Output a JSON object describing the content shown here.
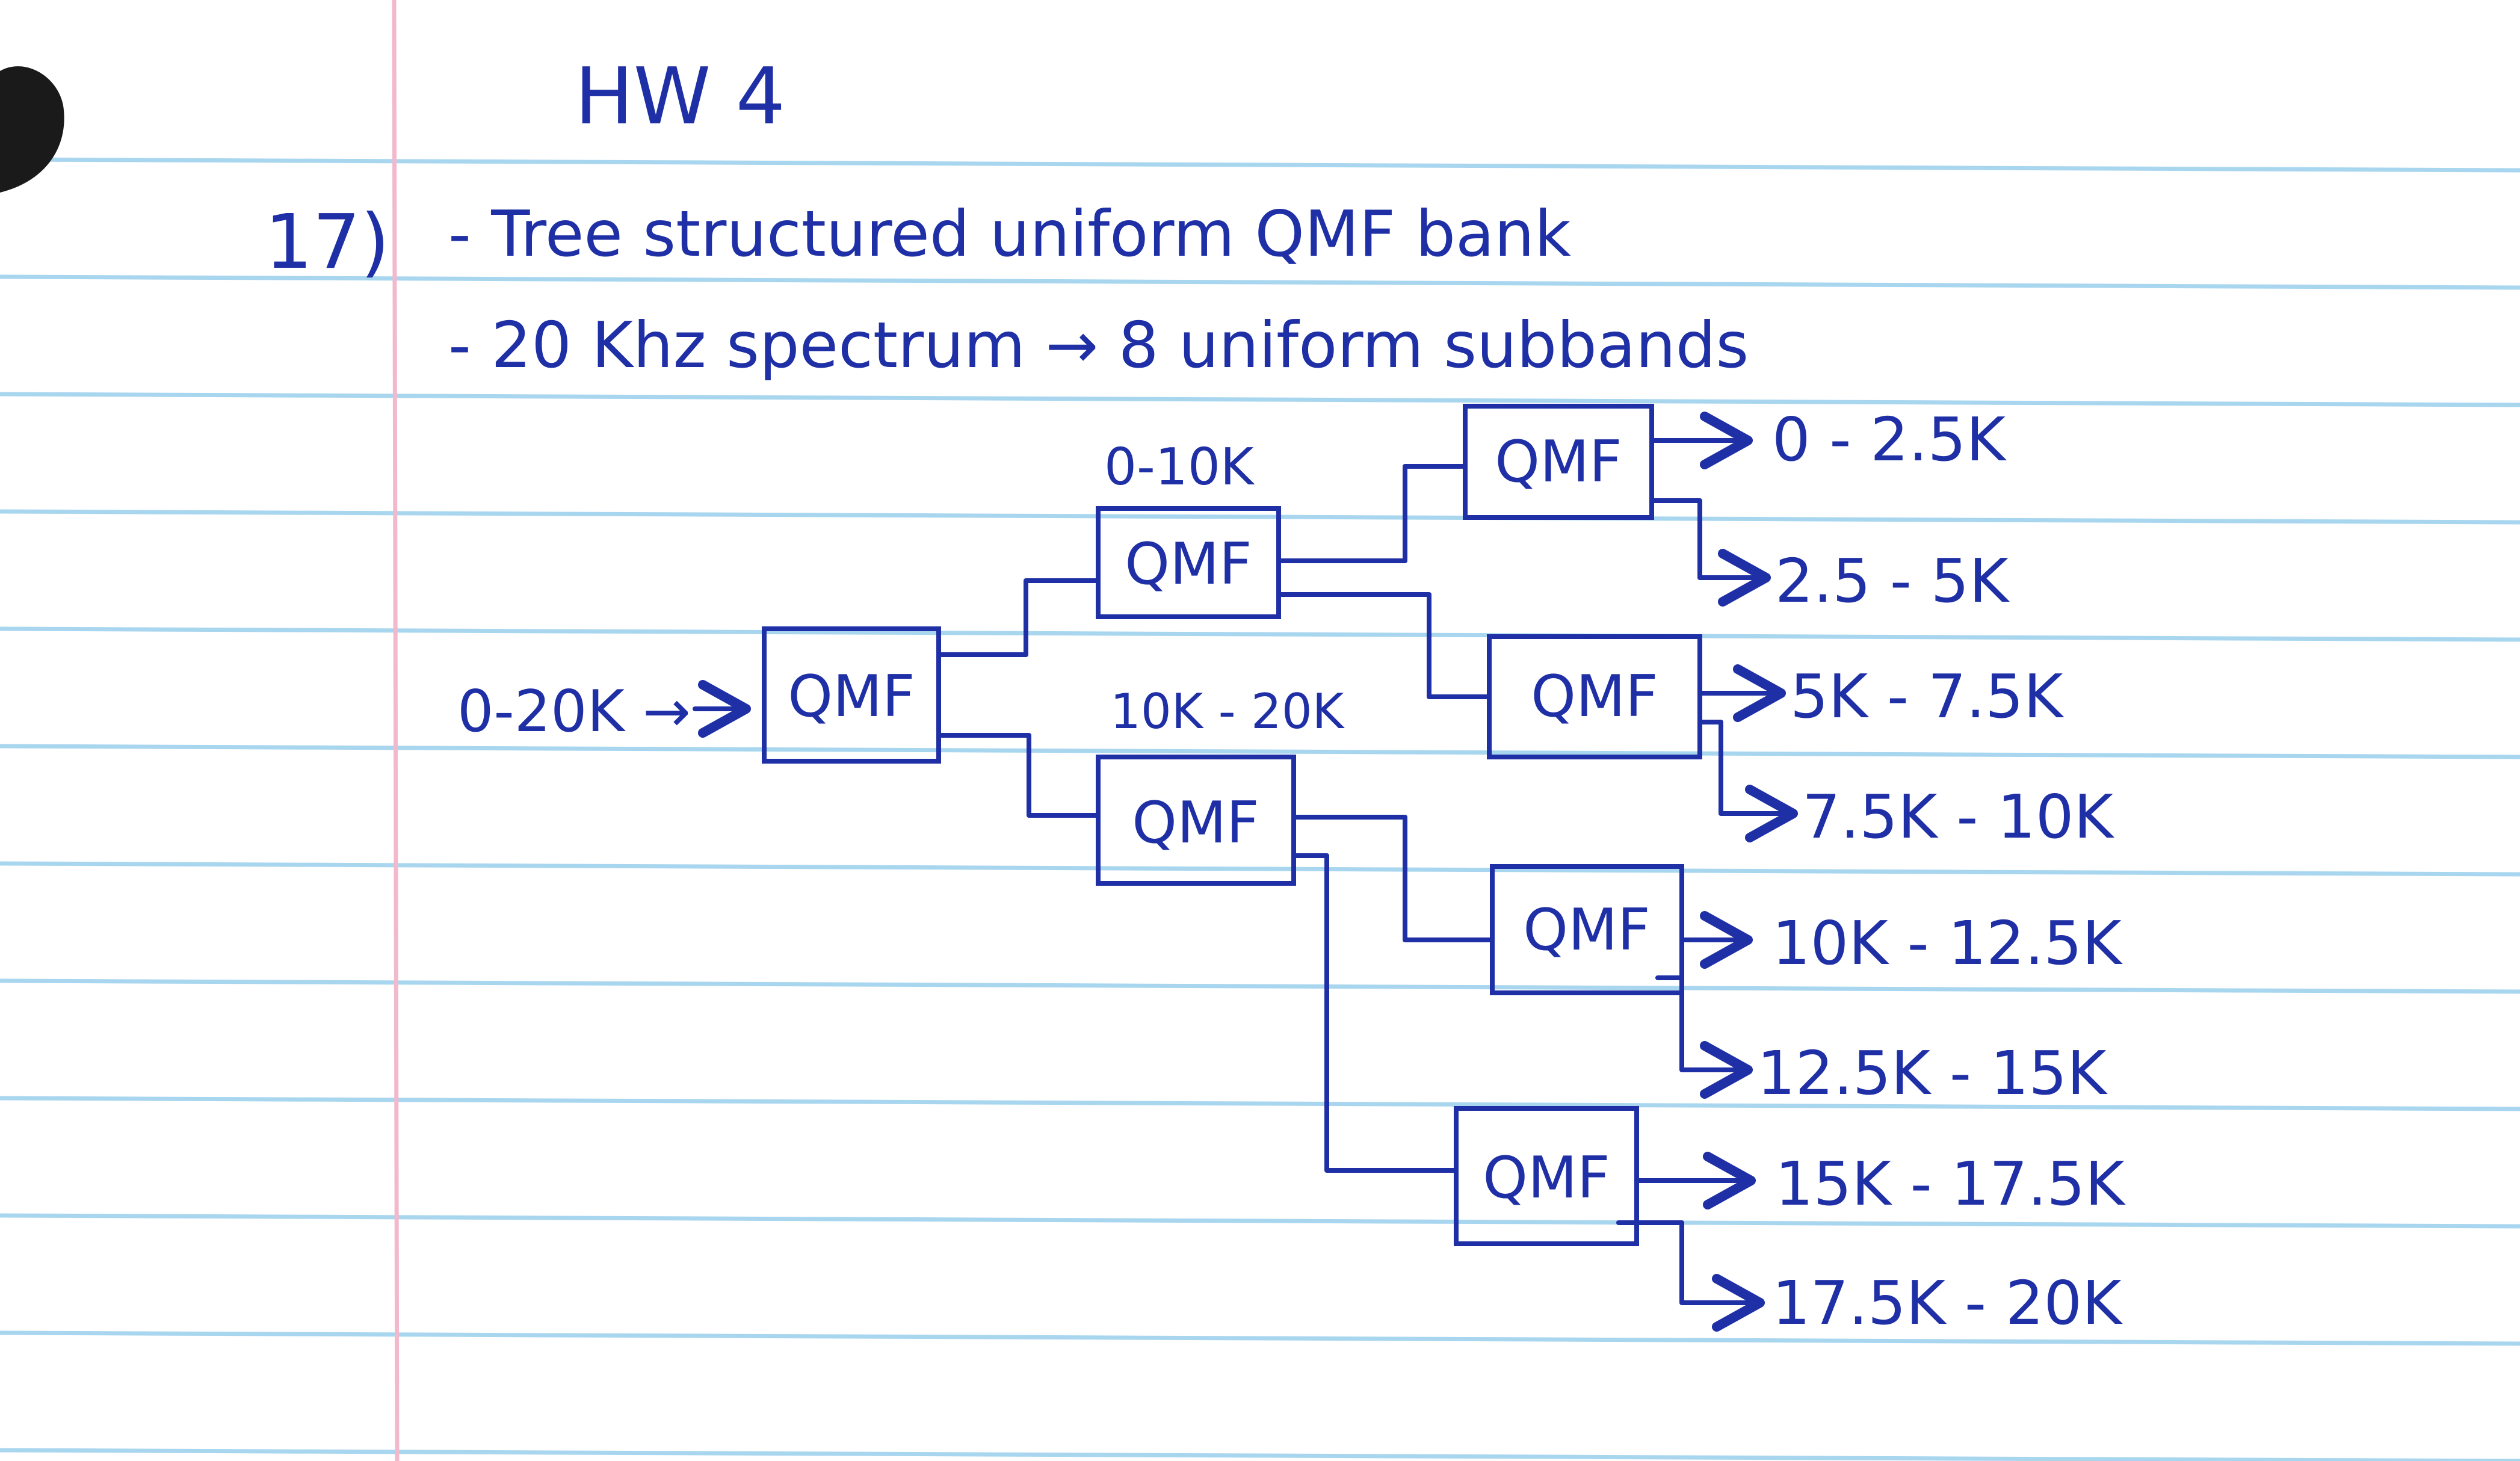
{
  "heading": "HW 4",
  "problem_number": "17)",
  "notes": [
    "- Tree structured uniform QMF bank",
    "- 20 Khz spectrum → 8 uniform subbands"
  ],
  "diagram": {
    "input_label": "0-20K →",
    "block_label": "QMF",
    "branch_labels": [
      "0-10K",
      "10K - 20K"
    ],
    "outputs": [
      "0 - 2.5K",
      "2.5 - 5K",
      "5K - 7.5K",
      "7.5K - 10K",
      "10K - 12.5K",
      "12.5K - 15K",
      "15K - 17.5K",
      "17.5K - 20K"
    ]
  },
  "colors": {
    "ink": "#1f2fa6",
    "ruled_line": "#a9d6ef",
    "margin_line": "#f2b8cc",
    "paper": "#ffffff",
    "binder_hole": "#1a1a1a"
  }
}
